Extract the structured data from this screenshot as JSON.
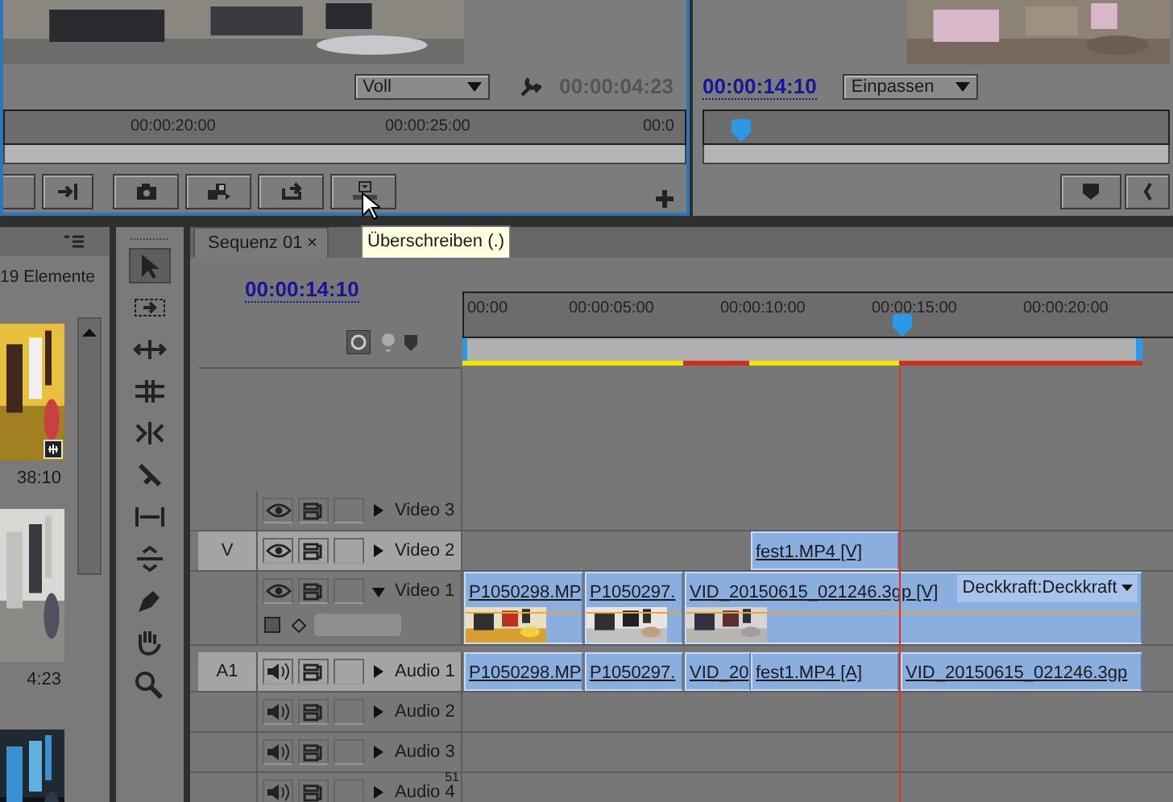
{
  "source_monitor": {
    "scale": "Voll",
    "timecode": "00:00:04:23",
    "ruler": [
      "00:00:20:00",
      "00:00:25:00",
      "00:0"
    ]
  },
  "program_monitor": {
    "timecode": "00:00:14:10",
    "scale": "Einpassen"
  },
  "tooltip": {
    "text": "Überschreiben (.)"
  },
  "project": {
    "count": "19 Elemente",
    "items": [
      {
        "duration": "38:10"
      },
      {
        "duration": "4:23"
      }
    ]
  },
  "tools": [
    {
      "selected": true
    },
    {
      "selected": false
    },
    {
      "selected": false
    },
    {
      "selected": false
    },
    {
      "selected": false
    },
    {
      "selected": false
    },
    {
      "selected": false
    },
    {
      "selected": false
    },
    {
      "selected": false
    },
    {
      "selected": false
    },
    {
      "selected": false
    }
  ],
  "sequence": {
    "tab": "Sequenz 01",
    "close": "×",
    "timecode": "00:00:14:10",
    "ruler": [
      "00:00",
      "00:00:05:00",
      "00:00:10:00",
      "00:00:15:00",
      "00:00:20:00"
    ],
    "render_bar": [
      {
        "color": "#f0e800"
      },
      {
        "color": "#d03020"
      },
      {
        "color": "#f0e800"
      },
      {
        "color": "#d03020"
      }
    ],
    "tracks": [
      {
        "kind": "video",
        "name": "Video 3",
        "targeted": false,
        "expanded": false
      },
      {
        "kind": "video",
        "name": "Video 2",
        "target": "V",
        "targeted": true,
        "expanded": false,
        "clips": [
          {
            "label": "fest1.MP4 [V]"
          }
        ]
      },
      {
        "kind": "video",
        "name": "Video 1",
        "targeted": false,
        "expanded": true,
        "clips": [
          {
            "label": "P1050298.MP",
            "thumbnail": true
          },
          {
            "label": "P1050297.",
            "thumbnail": true
          },
          {
            "label": "VID_20150615_021246.3gp [V]",
            "thumbnail": true,
            "effect": "Deckkraft:Deckkraft"
          }
        ]
      },
      {
        "kind": "audio",
        "name": "Audio 1",
        "target": "A1",
        "targeted": true,
        "expanded": false,
        "clips": [
          {
            "label": "P1050298.MP"
          },
          {
            "label": "P1050297."
          },
          {
            "label": "VID_20"
          },
          {
            "label": "fest1.MP4 [A]"
          },
          {
            "label": "VID_20150615_021246.3gp"
          }
        ]
      },
      {
        "kind": "audio",
        "name": "Audio 2",
        "targeted": false,
        "expanded": false
      },
      {
        "kind": "audio",
        "name": "Audio 3",
        "targeted": false,
        "expanded": false
      },
      {
        "kind": "audio",
        "name": "Audio 4",
        "badge": "51",
        "targeted": false,
        "expanded": false
      }
    ]
  }
}
